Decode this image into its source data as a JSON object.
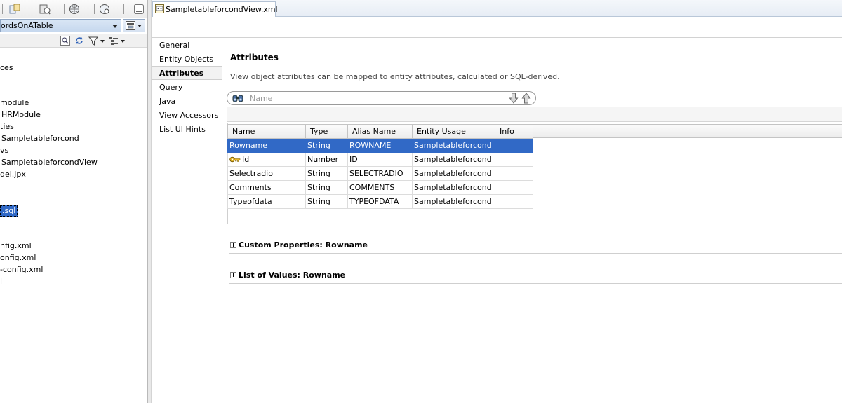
{
  "left": {
    "app_combo_value": "ordsOnATable",
    "tree_items": [
      "ces",
      "module",
      "HRModule",
      "ties",
      "Sampletableforcond",
      "vs",
      "SampletableforcondView",
      "del.jpx",
      "nfig.xml",
      "onfig.xml",
      "-config.xml",
      "l"
    ],
    "selected_item": ".sql"
  },
  "editor": {
    "tab_title": "SampletableforcondView.xml"
  },
  "nav": {
    "items": [
      "General",
      "Entity Objects",
      "Attributes",
      "Query",
      "Java",
      "View Accessors",
      "List UI Hints"
    ],
    "active": "Attributes"
  },
  "attributes": {
    "title": "Attributes",
    "description": "View object attributes can be mapped to entity attributes, calculated or SQL-derived.",
    "search_placeholder": "Name",
    "columns": [
      "Name",
      "Type",
      "Alias Name",
      "Entity Usage",
      "Info"
    ],
    "rows": [
      {
        "name": "Rowname",
        "type": "String",
        "alias": "ROWNAME",
        "entity": "Sampletableforcond",
        "info": "",
        "key": false,
        "selected": true
      },
      {
        "name": "Id",
        "type": "Number",
        "alias": "ID",
        "entity": "Sampletableforcond",
        "info": "",
        "key": true,
        "selected": false
      },
      {
        "name": "Selectradio",
        "type": "String",
        "alias": "SELECTRADIO",
        "entity": "Sampletableforcond",
        "info": "",
        "key": false,
        "selected": false
      },
      {
        "name": "Comments",
        "type": "String",
        "alias": "COMMENTS",
        "entity": "Sampletableforcond",
        "info": "",
        "key": false,
        "selected": false
      },
      {
        "name": "Typeofdata",
        "type": "String",
        "alias": "TYPEOFDATA",
        "entity": "Sampletableforcond",
        "info": "",
        "key": false,
        "selected": false
      }
    ],
    "custom_properties_label": "Custom Properties: Rowname",
    "list_of_values_label": "List of Values: Rowname"
  },
  "colors": {
    "selection": "#3169c6",
    "header_bg": "#ececec",
    "combo_bg": "#c6d8ee"
  },
  "icons": {
    "key": "key-icon",
    "search": "binoculars-icon",
    "move_down": "arrow-down-icon",
    "move_up": "arrow-up-icon",
    "xml_file": "xml-file-icon"
  }
}
